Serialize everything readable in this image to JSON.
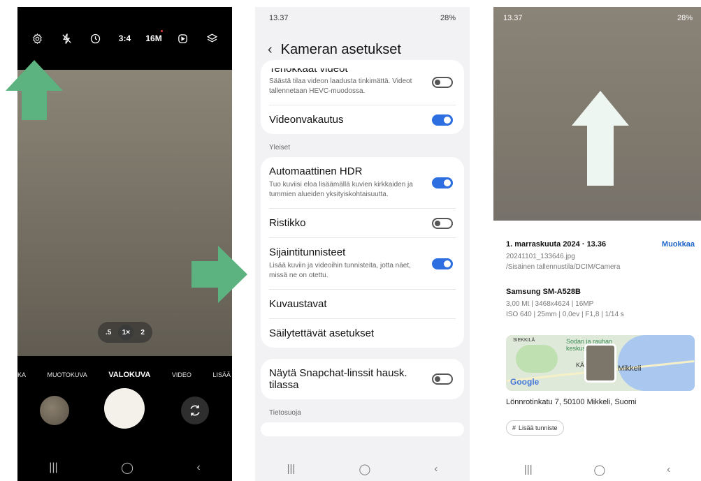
{
  "phone_camera": {
    "top_icons": {
      "settings_icon": "gear-icon",
      "flash_icon": "flash-off-icon",
      "timer_icon": "timer-icon",
      "ratio": "3:4",
      "resolution": "16M",
      "motion_icon": "motion-photo-icon",
      "filters_icon": "filters-icon"
    },
    "zoom": {
      "opt1": ".5",
      "opt2": "1×",
      "opt3": "2"
    },
    "modes": [
      "KA",
      "MUOTOKUVA",
      "VALOKUVA",
      "VIDEO",
      "LISÄÄ"
    ],
    "active_mode": "VALOKUVA",
    "nav": {
      "recent": "|||",
      "home": "◯",
      "back": "‹"
    }
  },
  "phone_settings": {
    "status": {
      "time": "13.37",
      "right": "28%"
    },
    "title": "Kameran asetukset",
    "back": "‹",
    "card1": [
      {
        "title": "Tehokkaat videot",
        "subtitle": "Säästä tilaa videon laadusta tinkimättä. Videot tallennetaan HEVC-muodossa.",
        "toggle": "off"
      },
      {
        "title": "Videonvakautus",
        "subtitle": "",
        "toggle": "on"
      }
    ],
    "section_general": "Yleiset",
    "card2": [
      {
        "title": "Automaattinen HDR",
        "subtitle": "Tuo kuviisi eloa lisäämällä kuvien kirkkaiden ja tummien alueiden yksityiskohtaisuutta.",
        "toggle": "on"
      },
      {
        "title": "Ristikko",
        "subtitle": "",
        "toggle": "off"
      },
      {
        "title": "Sijaintitunnisteet",
        "subtitle": "Lisää kuviin ja videoihin tunnisteita, jotta näet, missä ne on otettu.",
        "toggle": "on"
      },
      {
        "title": "Kuvaustavat",
        "subtitle": "",
        "toggle": "none"
      },
      {
        "title": "Säilytettävät asetukset",
        "subtitle": "",
        "toggle": "none"
      }
    ],
    "card3": [
      {
        "title": "Näytä Snapchat-linssit hausk. tilassa",
        "subtitle": "",
        "toggle": "off"
      }
    ],
    "section_privacy": "Tietosuoja",
    "nav": {
      "recent": "|||",
      "home": "◯",
      "back": "‹"
    }
  },
  "phone_gallery": {
    "status": {
      "time": "13.37",
      "right": "28%"
    },
    "date": "1. marraskuuta 2024 · 13.36",
    "edit": "Muokkaa",
    "filename": "20241101_133646.jpg",
    "path": "/Sisäinen tallennustila/DCIM/Camera",
    "device": "Samsung SM-A528B",
    "specs1": "3,00 Mt  |  3468x4624  |  16MP",
    "specs2": "ISO 640  |  25mm  |  0,0ev  |  F1,8  |  1/14 s",
    "map": {
      "label1": "SIEKKILÄ",
      "label2": "Sodan ja rauhan keskus",
      "label3": "KÄ",
      "label4": "Mikkeli",
      "google": "Google"
    },
    "address": "Lönnrotinkatu 7, 50100 Mikkeli, Suomi",
    "tag_button": "Lisää tunniste",
    "nav": {
      "recent": "|||",
      "home": "◯",
      "back": "‹"
    }
  },
  "colors": {
    "arrow_green": "#5cb37f",
    "arrow_pale": "#eef6f1",
    "toggle_on": "#2d6fe0",
    "link_blue": "#1d64c8"
  }
}
